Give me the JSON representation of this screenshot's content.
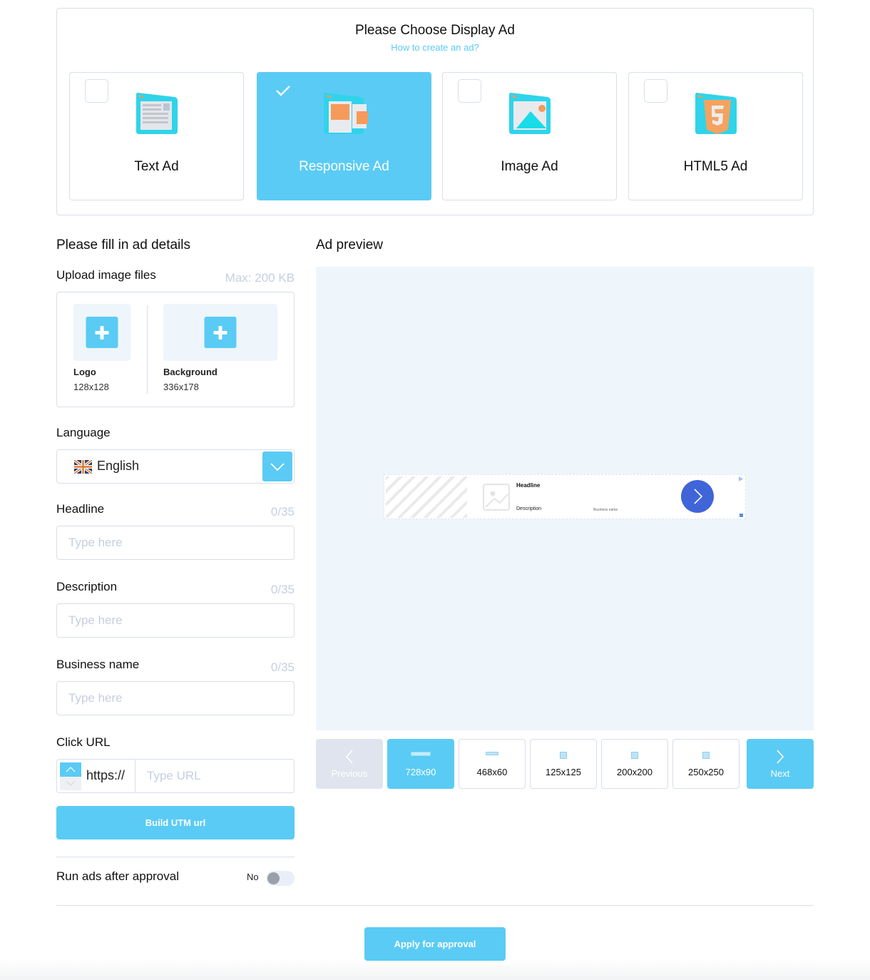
{
  "chooser": {
    "title": "Please Choose Display Ad",
    "help_link": "How to create an ad?",
    "options": [
      {
        "label": "Text Ad",
        "selected": false
      },
      {
        "label": "Responsive Ad",
        "selected": true
      },
      {
        "label": "Image Ad",
        "selected": false
      },
      {
        "label": "HTML5 Ad",
        "selected": false
      }
    ]
  },
  "details": {
    "title": "Please fill in ad details",
    "upload": {
      "label": "Upload image files",
      "max_size": "Max: 200 KB",
      "tiles": [
        {
          "name": "Logo",
          "size": "128x128"
        },
        {
          "name": "Background",
          "size": "336x178"
        }
      ]
    },
    "language": {
      "label": "Language",
      "value": "English",
      "flag": "uk-flag-icon"
    },
    "headline": {
      "label": "Headline",
      "counter": "0/35",
      "placeholder": "Type here",
      "value": ""
    },
    "description": {
      "label": "Description",
      "counter": "0/35",
      "placeholder": "Type here",
      "value": ""
    },
    "business_name": {
      "label": "Business name",
      "counter": "0/35",
      "placeholder": "Type here",
      "value": ""
    },
    "click_url": {
      "label": "Click URL",
      "protocol": "https://",
      "placeholder": "Type URL",
      "value": ""
    },
    "build_utm_label": "Build UTM url",
    "run_after_approval": {
      "label": "Run ads after approval",
      "state": "No",
      "on": false
    }
  },
  "preview": {
    "title": "Ad preview",
    "banner": {
      "headline": "Headline",
      "description": "Description",
      "business_name": "Business name",
      "cta_color": "#3f65d8"
    },
    "previous_label": "Previous",
    "next_label": "Next",
    "sizes": [
      {
        "label": "728x90",
        "active": true
      },
      {
        "label": "468x60",
        "active": false
      },
      {
        "label": "125x125",
        "active": false
      },
      {
        "label": "200x200",
        "active": false
      },
      {
        "label": "250x250",
        "active": false
      }
    ]
  },
  "footer": {
    "apply_label": "Apply for approval"
  },
  "colors": {
    "accent": "#5acbf5",
    "border": "#d8dee9",
    "preview_bg": "#eef5fb",
    "muted_text": "#c5cfe0"
  }
}
